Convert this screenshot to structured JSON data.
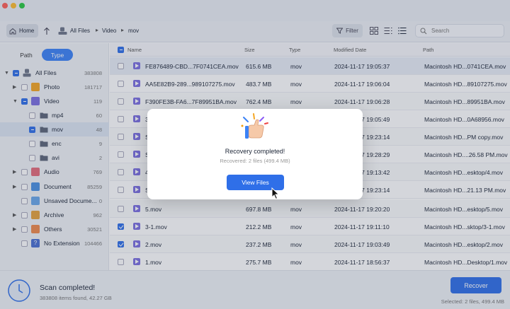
{
  "toolbar": {
    "home_label": "Home",
    "breadcrumb": [
      "All Files",
      "Video",
      "mov"
    ],
    "filter_label": "Filter",
    "search_placeholder": "Search"
  },
  "sidebar": {
    "tabs": [
      "Path",
      "Type"
    ],
    "active_tab": "Type",
    "tree": [
      {
        "label": "All Files",
        "count": "383808",
        "icon": "all-files-icon"
      },
      {
        "label": "Photo",
        "count": "181717",
        "icon": "photo-icon"
      },
      {
        "label": "Video",
        "count": "119",
        "icon": "video-icon"
      },
      {
        "label": "mp4",
        "count": "60",
        "icon": "folder-icon"
      },
      {
        "label": "mov",
        "count": "48",
        "icon": "folder-icon"
      },
      {
        "label": "enc",
        "count": "9",
        "icon": "folder-icon"
      },
      {
        "label": "avi",
        "count": "2",
        "icon": "folder-icon"
      },
      {
        "label": "Audio",
        "count": "769",
        "icon": "audio-icon"
      },
      {
        "label": "Document",
        "count": "85259",
        "icon": "document-icon"
      },
      {
        "label": "Unsaved Docume...",
        "count": "0",
        "icon": "unsaved-doc-icon"
      },
      {
        "label": "Archive",
        "count": "962",
        "icon": "archive-icon"
      },
      {
        "label": "Others",
        "count": "30521",
        "icon": "others-icon"
      },
      {
        "label": "No Extension",
        "count": "104466",
        "icon": "question-icon"
      }
    ]
  },
  "table": {
    "headers": [
      "Name",
      "Size",
      "Type",
      "Modified Date",
      "Path"
    ],
    "rows": [
      {
        "name": "FE876489-CBD...7F0741CEA.mov",
        "size": "615.6 MB",
        "type": "mov",
        "date": "2024-11-17 19:05:37",
        "path": "Macintosh HD...0741CEA.mov"
      },
      {
        "name": "AA5E82B9-289...989107275.mov",
        "size": "483.7 MB",
        "type": "mov",
        "date": "2024-11-17 19:06:04",
        "path": "Macintosh HD...89107275.mov"
      },
      {
        "name": "F390FE3B-FA6...7F89951BA.mov",
        "size": "762.4 MB",
        "type": "mov",
        "date": "2024-11-17 19:06:28",
        "path": "Macintosh HD...89951BA.mov"
      },
      {
        "name": "3",
        "size": "",
        "type": "",
        "date": "2024-11-17 19:05:49",
        "path": "Macintosh HD...0A68956.mov"
      },
      {
        "name": "S",
        "size": "",
        "type": "",
        "date": "2024-11-17 19:23:14",
        "path": "Macintosh HD...PM copy.mov"
      },
      {
        "name": "S",
        "size": "",
        "type": "",
        "date": "2024-11-17 19:28:29",
        "path": "Macintosh HD....26.58 PM.mov"
      },
      {
        "name": "4",
        "size": "",
        "type": "",
        "date": "2024-11-17 19:13:42",
        "path": "Macintosh HD...esktop/4.mov"
      },
      {
        "name": "S",
        "size": "",
        "type": "",
        "date": "2024-11-17 19:23:14",
        "path": "Macintosh HD...21.13 PM.mov"
      },
      {
        "name": "5.mov",
        "size": "697.8 MB",
        "type": "mov",
        "date": "2024-11-17 19:20:20",
        "path": "Macintosh HD...esktop/5.mov"
      },
      {
        "name": "3-1.mov",
        "size": "212.2 MB",
        "type": "mov",
        "date": "2024-11-17 19:11:10",
        "path": "Macintosh HD...sktop/3-1.mov"
      },
      {
        "name": "2.mov",
        "size": "237.2 MB",
        "type": "mov",
        "date": "2024-11-17 19:03:49",
        "path": "Macintosh HD...esktop/2.mov"
      },
      {
        "name": "1.mov",
        "size": "275.7 MB",
        "type": "mov",
        "date": "2024-11-17 18:56:37",
        "path": "Macintosh HD...Desktop/1.mov"
      }
    ]
  },
  "footer": {
    "scan_title": "Scan completed!",
    "scan_sub": "383808 items found, 42.27 GB",
    "recover_label": "Recover",
    "selected_text": "Selected: 2 files, 499.4 MB"
  },
  "modal": {
    "title": "Recovery completed!",
    "subtitle": "Recovered: 2 files (499.4 MB)",
    "button_label": "View Files"
  },
  "colors": {
    "accent": "#2f6fe8",
    "video_icon": "#7b6fe0"
  }
}
